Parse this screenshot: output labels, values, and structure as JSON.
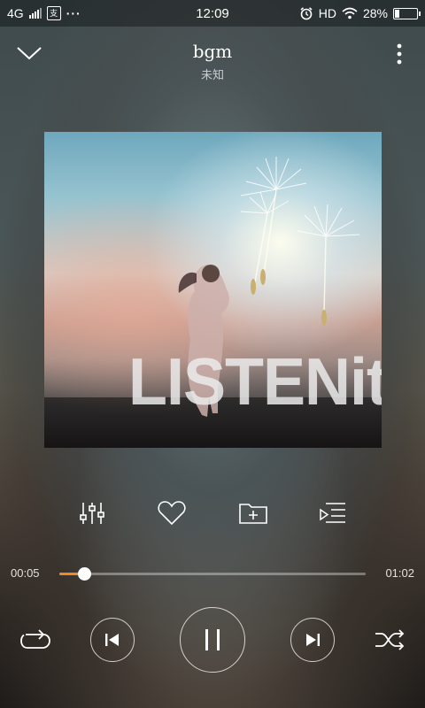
{
  "status_bar": {
    "network": "4G",
    "app_badge": "支",
    "dots": "···",
    "time": "12:09",
    "hd": "HD",
    "battery_text": "28%",
    "battery_level": 0.28,
    "icons": [
      "signal-icon",
      "alarm-icon",
      "wifi-icon",
      "battery-icon"
    ]
  },
  "header": {
    "title": "bgm",
    "subtitle": "未知",
    "icons": [
      "chevron-down-icon",
      "more-vertical-icon"
    ]
  },
  "album": {
    "logo_text": "LISTENit"
  },
  "actions": {
    "icons": [
      "equalizer-icon",
      "heart-icon",
      "add-to-folder-icon",
      "playlist-icon"
    ]
  },
  "progress": {
    "current": "00:05",
    "total": "01:02",
    "fraction": 0.08,
    "accent": "#f08a24"
  },
  "controls": {
    "icons": [
      "repeat-icon",
      "previous-icon",
      "pause-icon",
      "next-icon",
      "shuffle-icon"
    ]
  }
}
